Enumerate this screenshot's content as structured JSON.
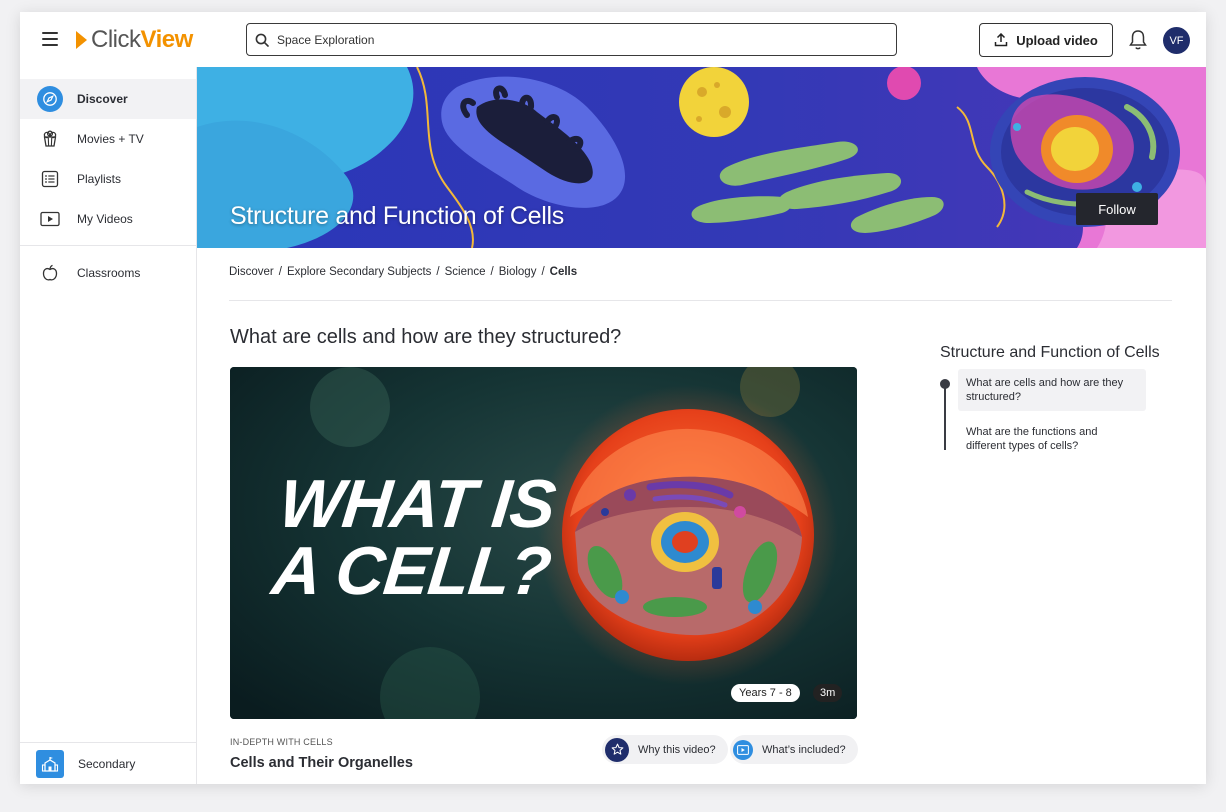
{
  "app": {
    "logo_left": "Click",
    "logo_right": "View"
  },
  "header": {
    "search_value": "Space Exploration",
    "upload_label": "Upload video",
    "avatar_initials": "VF"
  },
  "sidebar": {
    "items": [
      {
        "label": "Discover",
        "icon": "compass-icon",
        "active": true
      },
      {
        "label": "Movies + TV",
        "icon": "popcorn-icon"
      },
      {
        "label": "Playlists",
        "icon": "list-icon"
      },
      {
        "label": "My Videos",
        "icon": "video-play-icon"
      },
      {
        "label": "Classrooms",
        "icon": "apple-icon"
      }
    ],
    "footer_label": "Secondary"
  },
  "banner": {
    "title": "Structure and Function of Cells",
    "follow_label": "Follow"
  },
  "breadcrumb": {
    "items": [
      "Discover",
      "Explore Secondary Subjects",
      "Science",
      "Biology"
    ],
    "current": "Cells"
  },
  "main": {
    "section_title": "What are cells and how are they structured?",
    "video": {
      "overlay_line1": "WHAT IS",
      "overlay_line2": "A CELL?",
      "years_badge": "Years 7 - 8",
      "duration_badge": "3m"
    },
    "eyebrow": "IN-DEPTH WITH CELLS",
    "video_title": "Cells and Their Organelles",
    "why_label": "Why this video?",
    "included_label": "What’s included?"
  },
  "outline": {
    "title": "Structure and Function of Cells",
    "items": [
      "What are cells and how are they structured?",
      "What are the functions and different types of cells?"
    ]
  },
  "colors": {
    "accent_blue": "#2f8ee0",
    "brand_orange": "#f39200",
    "avatar_navy": "#1f2d6b"
  }
}
